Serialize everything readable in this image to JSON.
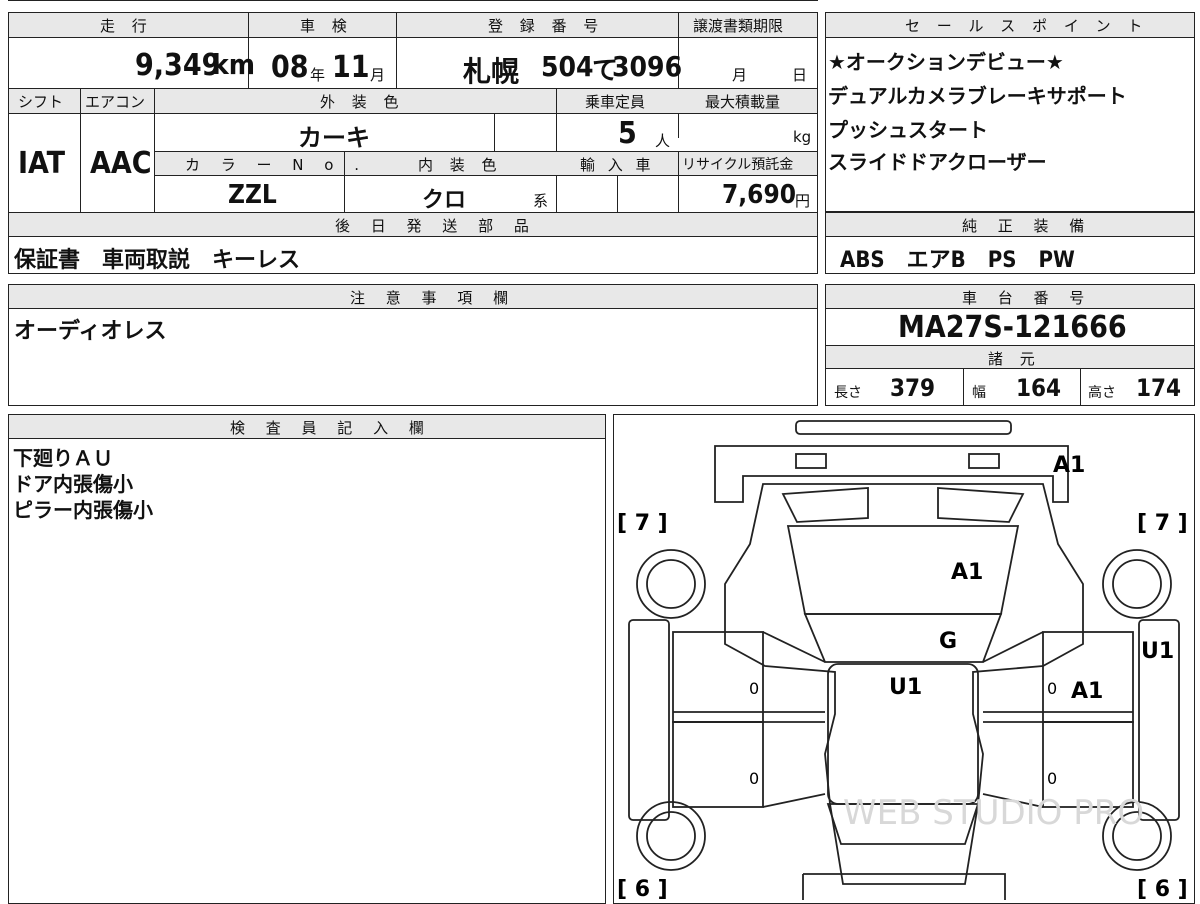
{
  "labels": {
    "mileage": "走 行",
    "inspection": "車 検",
    "registration": "登 録 番 号",
    "transfer_deadline": "譲渡書類期限",
    "sales_points": "セ ー ル ス ポ イ ン ト",
    "shift": "シフト",
    "aircon": "エアコン",
    "exterior_color": "外 装 色",
    "capacity": "乗車定員",
    "max_load": "最大積載量",
    "color_no": "カ ラ ー N o .",
    "interior_color": "内 装 色",
    "import": "輸 入 車",
    "recycle_fee": "リサイクル預託金",
    "later_parts": "後 日 発 送 部 品",
    "genuine_equipment": "純 正 装 備",
    "notes": "注 意 事 項 欄",
    "chassis_number": "車 台 番 号",
    "specs": "諸 元",
    "inspector": "検 査 員 記 入 欄"
  },
  "vehicle": {
    "mileage_value": "9,349",
    "mileage_unit": "km",
    "inspection_year": "08",
    "year_unit": "年",
    "inspection_month": "11",
    "month_unit": "月",
    "reg_city": "札幌",
    "reg_class": "504",
    "reg_kana": "て",
    "reg_number": "3096",
    "deadline_month": "月",
    "deadline_day": "日",
    "shift": "IAT",
    "aircon": "AAC",
    "exterior_color": "カーキ",
    "capacity_value": "5",
    "capacity_unit": "人",
    "max_load_unit": "kg",
    "color_no": "ZZL",
    "interior_color": "クロ",
    "interior_suffix": "系",
    "recycle_value": "7,690",
    "recycle_unit": "円",
    "later_parts": "保証書　車両取説　キーレス",
    "genuine_equipment": "ABS　エアB　PS　PW",
    "chassis_number": "MA27S-121666",
    "length_label": "長さ",
    "length_value": "379",
    "width_label": "幅",
    "width_value": "164",
    "height_label": "高さ",
    "height_value": "174"
  },
  "sales_points": [
    "★オークションデビュー★",
    "デュアルカメラブレーキサポート",
    "プッシュスタート",
    "スライドドアクローザー"
  ],
  "notes_text": "オーディオレス",
  "inspector_notes": [
    "下廻りＡＵ",
    "ドア内張傷小",
    "ピラー内張傷小"
  ],
  "diagram": {
    "front_left_tire": "[ 7 ]",
    "front_right_tire": "[ 7 ]",
    "rear_left_tire": "[ 6 ]",
    "rear_right_tire": "[ 6 ]",
    "marks": {
      "front_bumper": "A1",
      "hood": "A1",
      "windshield": "G",
      "roof": "U1",
      "right_door": "A1",
      "right_side": "U1"
    },
    "zero_left_front": "0",
    "zero_left_rear": "0",
    "zero_right_front": "0",
    "zero_right_rear": "0",
    "watermark": "WEB STUDIO PRO"
  }
}
